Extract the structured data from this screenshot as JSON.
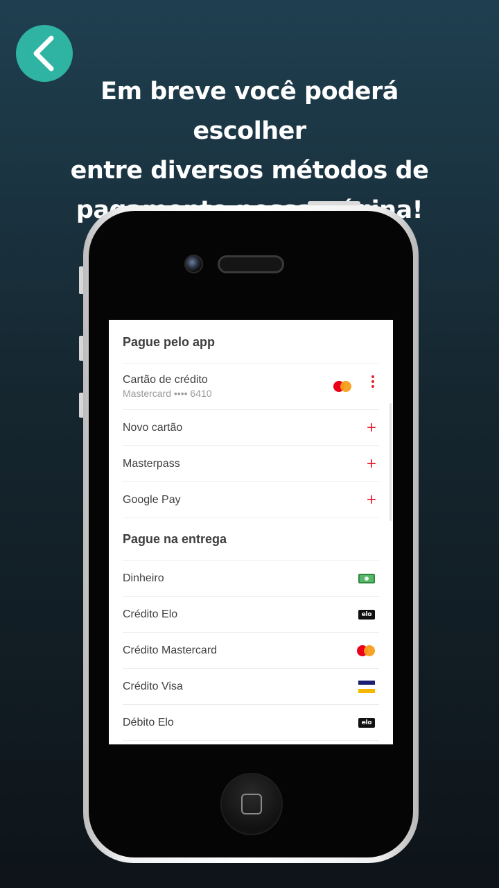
{
  "headline": {
    "line1": "Em breve você poderá escolher",
    "line2": "entre diversos métodos de",
    "line3": "pagamento nessa página!"
  },
  "icons": {
    "back": "chevron-left-icon",
    "card_brand": "mastercard-icon",
    "more": "kebab-menu-icon",
    "add": "plus-icon",
    "cash": "cash-icon",
    "elo": "elo-icon",
    "visa": "visa-icon"
  },
  "colors": {
    "accent": "#ea1d2c",
    "back_button": "#2fb3a2"
  },
  "screen": {
    "app_section": {
      "title": "Pague pelo app",
      "saved_card": {
        "title": "Cartão de crédito",
        "subtitle": "Mastercard •••• 6410"
      },
      "options": [
        {
          "label": "Novo cartão"
        },
        {
          "label": "Masterpass"
        },
        {
          "label": "Google Pay"
        }
      ]
    },
    "delivery_section": {
      "title": "Pague na entrega",
      "options": [
        {
          "label": "Dinheiro",
          "icon": "cash-icon"
        },
        {
          "label": "Crédito Elo",
          "icon": "elo-icon",
          "icon_text": "elo"
        },
        {
          "label": "Crédito Mastercard",
          "icon": "mastercard-icon"
        },
        {
          "label": "Crédito Visa",
          "icon": "visa-icon"
        },
        {
          "label": "Débito Elo",
          "icon": "elo-icon",
          "icon_text": "elo"
        }
      ]
    }
  }
}
